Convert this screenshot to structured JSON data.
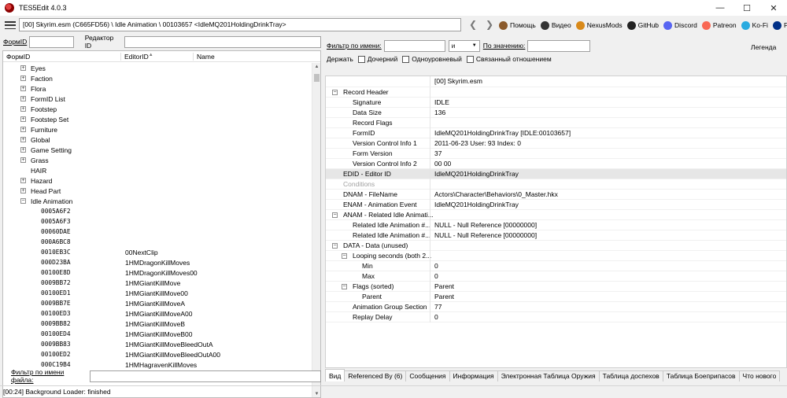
{
  "window": {
    "title": "TES5Edit 4.0.3",
    "minimize": "—",
    "maximize": "☐",
    "close": "✕"
  },
  "toolbar": {
    "path": "[00] Skyrim.esm (C665FD56) \\ Idle Animation \\ 00103657 <IdleMQ201HoldingDrinkTray>",
    "back": "❮",
    "forward": "❯",
    "links": [
      {
        "label": "Помощь",
        "color": "#8b5a2b"
      },
      {
        "label": "Видео",
        "color": "#333333"
      },
      {
        "label": "NexusMods",
        "color": "#d98a1a"
      },
      {
        "label": "GitHub",
        "color": "#222222"
      },
      {
        "label": "Discord",
        "color": "#5865f2"
      },
      {
        "label": "Patreon",
        "color": "#f96854"
      },
      {
        "label": "Ko-Fi",
        "color": "#29abe0"
      },
      {
        "label": "PayPal",
        "color": "#003087"
      }
    ]
  },
  "left": {
    "formid_label": "ФормID",
    "editorid_label": "Редактор ID",
    "columns": [
      "ФормID",
      "EditorID",
      "Name"
    ],
    "sort_arrow": "▲",
    "groups": [
      "Eyes",
      "Faction",
      "Flora",
      "FormID List",
      "Footstep",
      "Footstep Set",
      "Furniture",
      "Global",
      "Game Setting",
      "Grass",
      "HAIR",
      "Hazard",
      "Head Part",
      "Idle Animation"
    ],
    "records": [
      {
        "formid": "0005A6F2",
        "editorid": ""
      },
      {
        "formid": "0005A6F3",
        "editorid": ""
      },
      {
        "formid": "00060DAE",
        "editorid": ""
      },
      {
        "formid": "000A6BC8",
        "editorid": ""
      },
      {
        "formid": "0010EB3C",
        "editorid": "00NextClip"
      },
      {
        "formid": "000D23BA",
        "editorid": "1HMDragonKillMoves"
      },
      {
        "formid": "00100E8D",
        "editorid": "1HMDragonKillMoves00"
      },
      {
        "formid": "0009BB72",
        "editorid": "1HMGiantKillMove"
      },
      {
        "formid": "00100ED1",
        "editorid": "1HMGiantKillMove00"
      },
      {
        "formid": "0009BB7E",
        "editorid": "1HMGiantKillMoveA"
      },
      {
        "formid": "00100ED3",
        "editorid": "1HMGiantKillMoveA00"
      },
      {
        "formid": "0009BB82",
        "editorid": "1HMGiantKillMoveB"
      },
      {
        "formid": "00100ED4",
        "editorid": "1HMGiantKillMoveB00"
      },
      {
        "formid": "0009BB83",
        "editorid": "1HMGiantKillMoveBleedOutA"
      },
      {
        "formid": "00100ED2",
        "editorid": "1HMGiantKillMoveBleedOutA00"
      },
      {
        "formid": "000C19B4",
        "editorid": "1HMHagravenKillMoves"
      }
    ],
    "file_filter_label": "Фильтр по имени файла:"
  },
  "right": {
    "filter_name_label": "Фильтр по  имени:",
    "filter_op": "и",
    "filter_value_label": "По значению:",
    "legend": "Легенда",
    "keep_label": "Держать",
    "checkboxes": [
      "Дочерний",
      "Одноуровневый",
      "Связанный отношением"
    ],
    "file_header": "[00] Skyrim.esm",
    "rows": [
      {
        "name": "Record Header",
        "value": "",
        "level": 0,
        "exp": "⊟"
      },
      {
        "name": "Signature",
        "value": "IDLE",
        "level": 1
      },
      {
        "name": "Data Size",
        "value": "136",
        "level": 1
      },
      {
        "name": "Record Flags",
        "value": "",
        "level": 1
      },
      {
        "name": "FormID",
        "value": "IdleMQ201HoldingDrinkTray [IDLE:00103657]",
        "level": 1
      },
      {
        "name": "Version Control Info 1",
        "value": "2011-06-23 User: 93 Index: 0",
        "level": 1
      },
      {
        "name": "Form Version",
        "value": "37",
        "level": 1
      },
      {
        "name": "Version Control Info 2",
        "value": "00 00",
        "level": 1
      },
      {
        "name": "EDID - Editor ID",
        "value": "IdleMQ201HoldingDrinkTray",
        "level": 0,
        "sel": true
      },
      {
        "name": "Conditions",
        "value": "",
        "level": 0,
        "muted": true
      },
      {
        "name": "DNAM - FileName",
        "value": "Actors\\Character\\Behaviors\\0_Master.hkx",
        "level": 0
      },
      {
        "name": "ENAM - Animation Event",
        "value": "IdleMQ201HoldingDrinkTray",
        "level": 0
      },
      {
        "name": "ANAM - Related Idle Animati...",
        "value": "",
        "level": 0,
        "exp": "⊟"
      },
      {
        "name": "Related Idle Animation #...",
        "value": "NULL - Null Reference [00000000]",
        "level": 1
      },
      {
        "name": "Related Idle Animation #...",
        "value": "NULL - Null Reference [00000000]",
        "level": 1
      },
      {
        "name": "DATA - Data (unused)",
        "value": "",
        "level": 0,
        "exp": "⊟"
      },
      {
        "name": "Looping seconds (both 2...",
        "value": "",
        "level": 1,
        "exp": "⊟"
      },
      {
        "name": "Min",
        "value": "0",
        "level": 2
      },
      {
        "name": "Max",
        "value": "0",
        "level": 2
      },
      {
        "name": "Flags (sorted)",
        "value": "Parent",
        "level": 1,
        "exp": "⊟"
      },
      {
        "name": "Parent",
        "value": "Parent",
        "level": 2
      },
      {
        "name": "Animation Group Section",
        "value": "77",
        "level": 1
      },
      {
        "name": "Replay Delay",
        "value": "0",
        "level": 1
      }
    ],
    "tabs": [
      "Вид",
      "Referenced By (6)",
      "Сообщения",
      "Информация",
      "Электронная Таблица Оружия",
      "Таблица доспехов",
      "Таблица Боеприпасов",
      "Что нового"
    ]
  },
  "status": "[00:24] Background Loader: finished"
}
